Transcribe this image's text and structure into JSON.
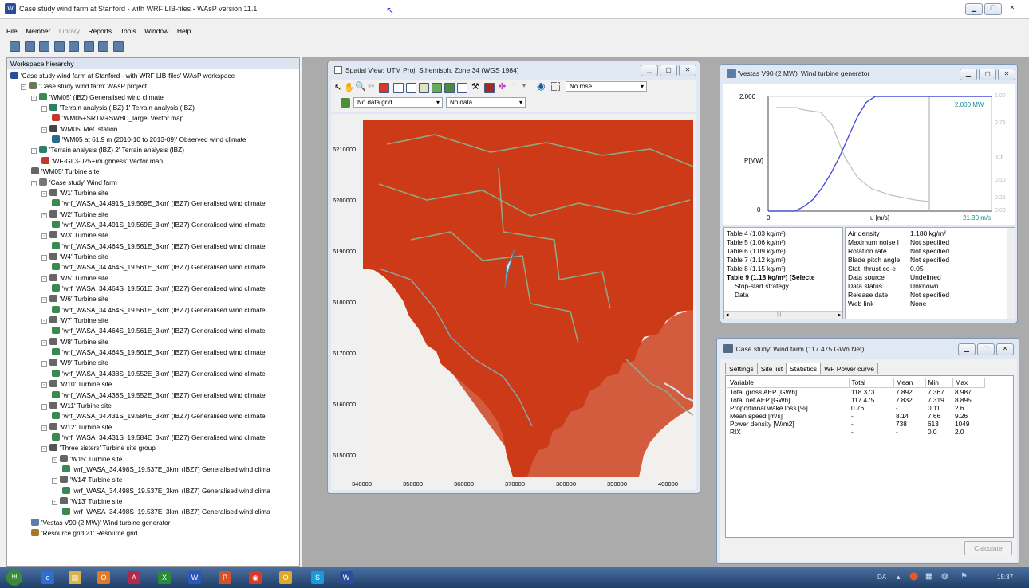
{
  "app": {
    "title": "Case study wind farm at Stanford - with WRF LIB-files - WAsP version 11.1",
    "icon": "wasp-app-icon"
  },
  "menu": {
    "items": [
      {
        "label": "File",
        "disabled": false
      },
      {
        "label": "Member",
        "disabled": false
      },
      {
        "label": "Library",
        "disabled": true
      },
      {
        "label": "Reports",
        "disabled": false
      },
      {
        "label": "Tools",
        "disabled": false
      },
      {
        "label": "Window",
        "disabled": false
      },
      {
        "label": "Help",
        "disabled": false
      }
    ]
  },
  "tree": {
    "header": "Workspace hierarchy",
    "nodes": [
      {
        "label": "'Case study wind farm at Stanford - with WRF LIB-files' WAsP workspace",
        "depth": 0,
        "icon": "workspace-icon",
        "expander": ""
      },
      {
        "label": "'Case study wind farm' WAsP project",
        "depth": 1,
        "icon": "project-icon",
        "expander": "-"
      },
      {
        "label": "'WM05' (IBZ) Generalised wind climate",
        "depth": 2,
        "icon": "gwc-icon",
        "expander": "-"
      },
      {
        "label": "'Terrain analysis (IBZ) 1' Terrain analysis (IBZ)",
        "depth": 3,
        "icon": "terrain-icon",
        "expander": "-"
      },
      {
        "label": "'WM05+SRTM+SWBD_large' Vector map",
        "depth": 4,
        "icon": "vector-map-icon",
        "expander": ""
      },
      {
        "label": "'WM05' Met. station",
        "depth": 3,
        "icon": "met-station-icon",
        "expander": "-"
      },
      {
        "label": "'WM05 at 61.9 m (2010-10 to 2013-09)' Observed wind climate",
        "depth": 4,
        "icon": "owc-icon",
        "expander": ""
      },
      {
        "label": "'Terrain analysis (IBZ) 2' Terrain analysis (IBZ)",
        "depth": 2,
        "icon": "terrain-icon",
        "expander": "-"
      },
      {
        "label": "'WF-GL3-025+roughness' Vector map",
        "depth": 3,
        "icon": "vector-map-icon",
        "expander": ""
      },
      {
        "label": "'WM05' Turbine site",
        "depth": 2,
        "icon": "turbine-site-icon",
        "expander": ""
      },
      {
        "label": "'Case study' Wind farm",
        "depth": 2,
        "icon": "wind-farm-icon",
        "expander": "-"
      },
      {
        "label": "'W1' Turbine site",
        "depth": 3,
        "icon": "turbine-site-icon",
        "expander": "-"
      },
      {
        "label": "'wrf_WASA_34.491S_19.569E_3km' (IBZ7) Generalised wind climate",
        "depth": 4,
        "icon": "gwc-icon",
        "expander": ""
      },
      {
        "label": "'W2' Turbine site",
        "depth": 3,
        "icon": "turbine-site-icon",
        "expander": "-"
      },
      {
        "label": "'wrf_WASA_34.491S_19.569E_3km' (IBZ7) Generalised wind climate",
        "depth": 4,
        "icon": "gwc-icon",
        "expander": ""
      },
      {
        "label": "'W3' Turbine site",
        "depth": 3,
        "icon": "turbine-site-icon",
        "expander": "-"
      },
      {
        "label": "'wrf_WASA_34.464S_19.561E_3km' (IBZ7) Generalised wind climate",
        "depth": 4,
        "icon": "gwc-icon",
        "expander": ""
      },
      {
        "label": "'W4' Turbine site",
        "depth": 3,
        "icon": "turbine-site-icon",
        "expander": "-"
      },
      {
        "label": "'wrf_WASA_34.464S_19.561E_3km' (IBZ7) Generalised wind climate",
        "depth": 4,
        "icon": "gwc-icon",
        "expander": ""
      },
      {
        "label": "'W5' Turbine site",
        "depth": 3,
        "icon": "turbine-site-icon",
        "expander": "-"
      },
      {
        "label": "'wrf_WASA_34.464S_19.561E_3km' (IBZ7) Generalised wind climate",
        "depth": 4,
        "icon": "gwc-icon",
        "expander": ""
      },
      {
        "label": "'W6' Turbine site",
        "depth": 3,
        "icon": "turbine-site-icon",
        "expander": "-"
      },
      {
        "label": "'wrf_WASA_34.464S_19.561E_3km' (IBZ7) Generalised wind climate",
        "depth": 4,
        "icon": "gwc-icon",
        "expander": ""
      },
      {
        "label": "'W7' Turbine site",
        "depth": 3,
        "icon": "turbine-site-icon",
        "expander": "-"
      },
      {
        "label": "'wrf_WASA_34.464S_19.561E_3km' (IBZ7) Generalised wind climate",
        "depth": 4,
        "icon": "gwc-icon",
        "expander": ""
      },
      {
        "label": "'W8' Turbine site",
        "depth": 3,
        "icon": "turbine-site-icon",
        "expander": "-"
      },
      {
        "label": "'wrf_WASA_34.464S_19.561E_3km' (IBZ7) Generalised wind climate",
        "depth": 4,
        "icon": "gwc-icon",
        "expander": ""
      },
      {
        "label": "'W9' Turbine site",
        "depth": 3,
        "icon": "turbine-site-icon",
        "expander": "-"
      },
      {
        "label": "'wrf_WASA_34.438S_19.552E_3km' (IBZ7) Generalised wind climate",
        "depth": 4,
        "icon": "gwc-icon",
        "expander": ""
      },
      {
        "label": "'W10' Turbine site",
        "depth": 3,
        "icon": "turbine-site-icon",
        "expander": "-"
      },
      {
        "label": "'wrf_WASA_34.438S_19.552E_3km' (IBZ7) Generalised wind climate",
        "depth": 4,
        "icon": "gwc-icon",
        "expander": ""
      },
      {
        "label": "'W11' Turbine site",
        "depth": 3,
        "icon": "turbine-site-icon",
        "expander": "-"
      },
      {
        "label": "'wrf_WASA_34.431S_19.584E_3km' (IBZ7) Generalised wind climate",
        "depth": 4,
        "icon": "gwc-icon",
        "expander": ""
      },
      {
        "label": "'W12' Turbine site",
        "depth": 3,
        "icon": "turbine-site-icon",
        "expander": "-"
      },
      {
        "label": "'wrf_WASA_34.431S_19.584E_3km' (IBZ7) Generalised wind climate",
        "depth": 4,
        "icon": "gwc-icon",
        "expander": ""
      },
      {
        "label": "'Three sisters' Turbine site group",
        "depth": 3,
        "icon": "site-group-icon",
        "expander": "-"
      },
      {
        "label": "'W15' Turbine site",
        "depth": 4,
        "icon": "turbine-site-icon",
        "expander": "-"
      },
      {
        "label": "'wrf_WASA_34.498S_19.537E_3km' (IBZ7) Generalised wind clima",
        "depth": 5,
        "icon": "gwc-icon",
        "expander": ""
      },
      {
        "label": "'W14' Turbine site",
        "depth": 4,
        "icon": "turbine-site-icon",
        "expander": "-"
      },
      {
        "label": "'wrf_WASA_34.498S_19.537E_3km' (IBZ7) Generalised wind clima",
        "depth": 5,
        "icon": "gwc-icon",
        "expander": ""
      },
      {
        "label": "'W13' Turbine site",
        "depth": 4,
        "icon": "turbine-site-icon",
        "expander": "-"
      },
      {
        "label": "'wrf_WASA_34.498S_19.537E_3km' (IBZ7) Generalised wind clima",
        "depth": 5,
        "icon": "gwc-icon",
        "expander": ""
      },
      {
        "label": "'Vestas V90 (2 MW)' Wind turbine generator",
        "depth": 2,
        "icon": "wtg-icon",
        "expander": ""
      },
      {
        "label": "'Resource grid 21' Resource grid",
        "depth": 2,
        "icon": "resource-grid-icon",
        "expander": ""
      }
    ]
  },
  "spatial": {
    "title": "Spatial View: UTM Proj. S.hemisph. Zone 34 (WGS 1984)",
    "rose_select": "No rose",
    "step_value": "1",
    "grid_select": "No data grid",
    "data_select": "No data",
    "x_ticks": [
      "340000",
      "350000",
      "360000",
      "370000",
      "380000",
      "390000",
      "400000"
    ],
    "y_ticks": [
      "6210000",
      "6200000",
      "6190000",
      "6180000",
      "6170000",
      "6160000",
      "6150000"
    ]
  },
  "wtg": {
    "title": "'Vestas V90 (2 MW)' Wind turbine generator",
    "y_top": "2.000",
    "y_bottom": "0",
    "x_left": "0",
    "x_right": "21.30 m/s",
    "x_label": "u [m/s]",
    "y_label": "P[MW]",
    "ct_label": "Ct",
    "ct_top": "1.00",
    "ct_mid": "0.75",
    "ct_low": "0.50",
    "ct_bottom": "0.25",
    "ct_zero": "0.00",
    "power_readout": "2.000 MW",
    "chart_data": {
      "type": "line",
      "series": [
        {
          "name": "P",
          "x": [
            0,
            3,
            4,
            5,
            6,
            7,
            8,
            9,
            10,
            11,
            12,
            13,
            25,
            21.3
          ],
          "values": [
            0,
            0,
            0.08,
            0.2,
            0.4,
            0.65,
            0.95,
            1.3,
            1.65,
            1.9,
            2.0,
            2.0,
            2.0,
            2.0
          ]
        }
      ]
    },
    "tables": [
      {
        "label": "Table 4 (1.03 kg/m³)",
        "bold": false
      },
      {
        "label": "Table 5 (1.06 kg/m³)",
        "bold": false
      },
      {
        "label": "Table 6 (1.09 kg/m³)",
        "bold": false
      },
      {
        "label": "Table 7 (1.12 kg/m³)",
        "bold": false
      },
      {
        "label": "Table 8 (1.15 kg/m³)",
        "bold": false
      },
      {
        "label": "Table 9 (1.18 kg/m³) [Selecte",
        "bold": true
      },
      {
        "label": "Stop-start strategy",
        "bold": false
      },
      {
        "label": "Data",
        "bold": false
      }
    ],
    "props": [
      {
        "k": "Air density",
        "v": "1.180 kg/m³"
      },
      {
        "k": "Maximum noise l",
        "v": "Not specified"
      },
      {
        "k": "Rotation rate",
        "v": "Not specified"
      },
      {
        "k": "Blade pitch angle",
        "v": "Not specified"
      },
      {
        "k": "Stat. thrust co-e",
        "v": "0.05"
      },
      {
        "k": "Data source",
        "v": "Undefined"
      },
      {
        "k": "Data status",
        "v": "Unknown"
      },
      {
        "k": "Release date",
        "v": "Not specified"
      },
      {
        "k": "Web link",
        "v": "None"
      }
    ]
  },
  "windfarm": {
    "title": "'Case study' Wind farm (117.475 GWh Net)",
    "tabs": [
      "Settings",
      "Site list",
      "Statistics",
      "WF Power curve"
    ],
    "active_tab": "Statistics",
    "columns": [
      "Variable",
      "Total",
      "Mean",
      "Min",
      "Max"
    ],
    "rows": [
      [
        "Total gross AEP [GWh]",
        "118.373",
        "7.892",
        "7.367",
        "8.987"
      ],
      [
        "Total net AEP [GWh]",
        "117.475",
        "7.832",
        "7.319",
        "8.895"
      ],
      [
        "Proportional wake loss [%]",
        "0.76",
        "-",
        "0.11",
        "2.6"
      ],
      [
        "Mean speed [m/s]",
        "-",
        "8.14",
        "7.66",
        "9.26"
      ],
      [
        "Power density [W/m2]",
        "-",
        "738",
        "613",
        "1049"
      ],
      [
        "RIX",
        "-",
        "-",
        "0.0",
        "2.0"
      ]
    ],
    "calculate_label": "Calculate"
  },
  "taskbar": {
    "lang": "DA",
    "time": "15:37"
  },
  "colors": {
    "map_land": "#cc3a17",
    "map_sea": "#f2f0ec",
    "power_curve": "#4b4fd0",
    "ct_curve": "#bfbfbf",
    "power_readout": "#138f8f"
  }
}
